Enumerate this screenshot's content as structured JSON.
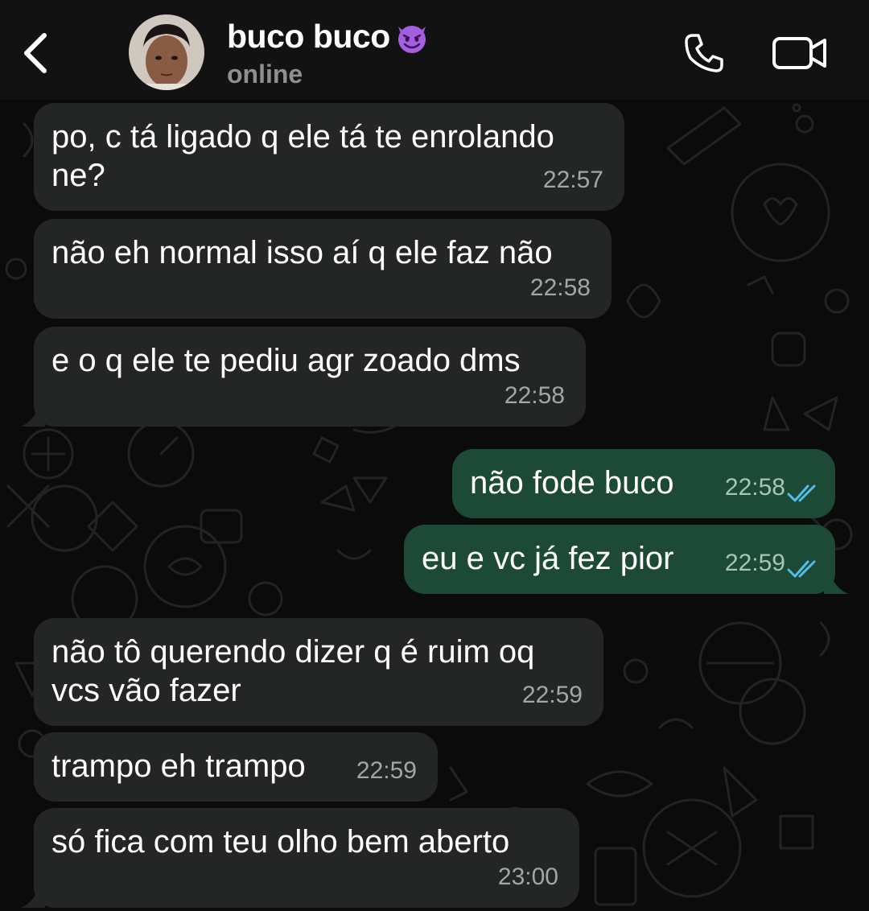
{
  "header": {
    "name": "buco buco",
    "status": "online",
    "icons": {
      "back": "chevron-left-icon",
      "call": "phone-icon",
      "video": "video-camera-icon",
      "emoji": "smiling-devil-emoji"
    }
  },
  "colors": {
    "header_bg": "#121212",
    "chat_bg": "#0b0b0b",
    "incoming_bubble": "#242626",
    "outgoing_bubble": "#1d4a36",
    "read_ticks": "#53bdeb",
    "status_text": "#8e8e93"
  },
  "messages": [
    {
      "direction": "in",
      "text": "po, c tá ligado q ele tá te enrolando\nne?",
      "time": "22:57"
    },
    {
      "direction": "in",
      "text": "não eh normal isso aí q ele faz não",
      "time": "22:58"
    },
    {
      "direction": "in",
      "text": "e o q ele te pediu agr zoado dms",
      "time": "22:58"
    },
    {
      "direction": "out",
      "text": "não fode buco",
      "time": "22:58",
      "read": true
    },
    {
      "direction": "out",
      "text": "eu e vc já fez pior",
      "time": "22:59",
      "read": true
    },
    {
      "direction": "in",
      "text": "não tô querendo dizer q é ruim oq\nvcs vão fazer",
      "time": "22:59"
    },
    {
      "direction": "in",
      "text": "trampo eh trampo",
      "time": "22:59"
    },
    {
      "direction": "in",
      "text": "só fica com teu olho bem aberto",
      "time": "23:00"
    }
  ]
}
